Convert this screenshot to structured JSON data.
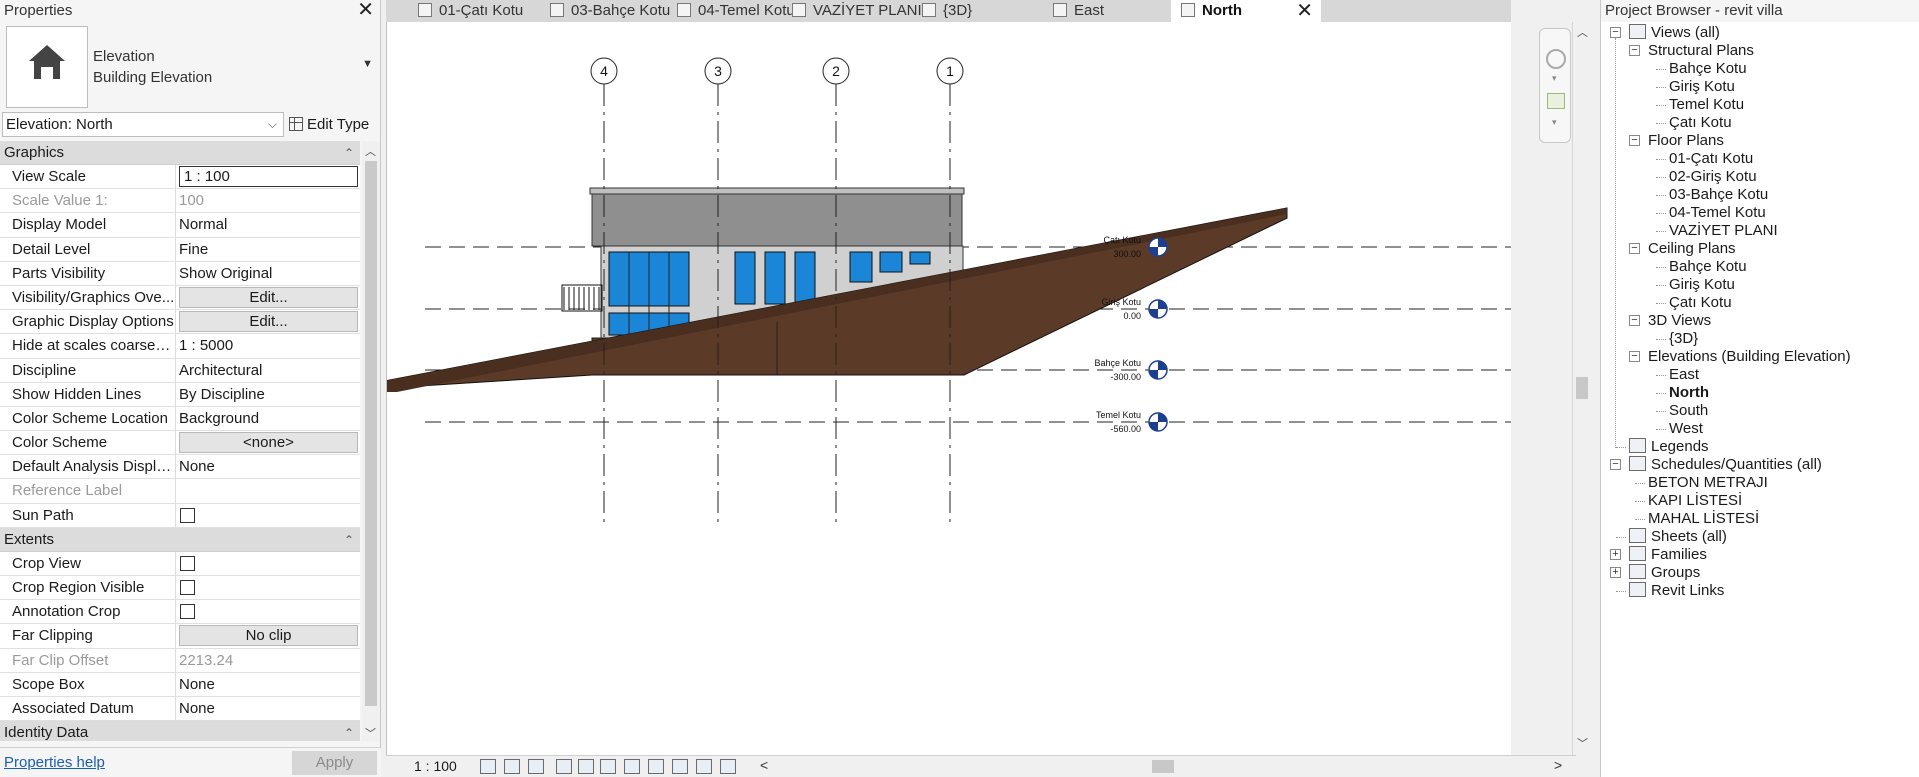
{
  "properties": {
    "title": "Properties",
    "type_category": "Elevation",
    "type_name": "Building Elevation",
    "instance_selector": "Elevation: North",
    "edit_type": "Edit Type",
    "sections": [
      {
        "name": "Graphics",
        "rows": [
          {
            "name": "View Scale",
            "value": "1 : 100",
            "kind": "boxed"
          },
          {
            "name": "Scale Value    1:",
            "value": "100",
            "kind": "grey"
          },
          {
            "name": "Display Model",
            "value": "Normal",
            "kind": "text"
          },
          {
            "name": "Detail Level",
            "value": "Fine",
            "kind": "text"
          },
          {
            "name": "Parts Visibility",
            "value": "Show Original",
            "kind": "text"
          },
          {
            "name": "Visibility/Graphics Ove...",
            "value": "Edit...",
            "kind": "btn"
          },
          {
            "name": "Graphic Display Options",
            "value": "Edit...",
            "kind": "btn"
          },
          {
            "name": "Hide at scales coarser ...",
            "value": "1 : 5000",
            "kind": "text"
          },
          {
            "name": "Discipline",
            "value": "Architectural",
            "kind": "text"
          },
          {
            "name": "Show Hidden Lines",
            "value": "By Discipline",
            "kind": "text"
          },
          {
            "name": "Color Scheme Location",
            "value": "Background",
            "kind": "text"
          },
          {
            "name": "Color Scheme",
            "value": "<none>",
            "kind": "btn"
          },
          {
            "name": "Default Analysis Displa...",
            "value": "None",
            "kind": "text"
          },
          {
            "name": "Reference Label",
            "value": "",
            "kind": "grey"
          },
          {
            "name": "Sun Path",
            "value": "",
            "kind": "check"
          }
        ]
      },
      {
        "name": "Extents",
        "rows": [
          {
            "name": "Crop View",
            "value": "",
            "kind": "check"
          },
          {
            "name": "Crop Region Visible",
            "value": "",
            "kind": "check"
          },
          {
            "name": "Annotation Crop",
            "value": "",
            "kind": "check"
          },
          {
            "name": "Far Clipping",
            "value": "No clip",
            "kind": "btn"
          },
          {
            "name": "Far Clip Offset",
            "value": "2213.24",
            "kind": "grey"
          },
          {
            "name": "Scope Box",
            "value": "None",
            "kind": "text"
          },
          {
            "name": "Associated Datum",
            "value": "None",
            "kind": "text"
          }
        ]
      },
      {
        "name": "Identity Data",
        "rows": []
      }
    ],
    "help_link": "Properties help",
    "apply_button": "Apply"
  },
  "tabs": [
    {
      "label": "01-Çatı Kotu",
      "icon": "floor-plan-icon",
      "active": false
    },
    {
      "label": "03-Bahçe Kotu",
      "icon": "floor-plan-icon",
      "active": false
    },
    {
      "label": "04-Temel Kotu",
      "icon": "floor-plan-icon",
      "active": false
    },
    {
      "label": "VAZİYET PLANI",
      "icon": "floor-plan-icon",
      "active": false
    },
    {
      "label": "{3D}",
      "icon": "cube-3d-icon",
      "active": false
    },
    {
      "label": "East",
      "icon": "elevation-icon",
      "active": false
    },
    {
      "label": "North",
      "icon": "elevation-icon",
      "active": true
    }
  ],
  "canvas": {
    "grids": [
      "4",
      "3",
      "2",
      "1"
    ],
    "levels": [
      {
        "name": "Çatı Kotu",
        "value": "300.00"
      },
      {
        "name": "Giriş Kotu",
        "value": "0.00"
      },
      {
        "name": "Bahçe Kotu",
        "value": "-300.00"
      },
      {
        "name": "Temel Kotu",
        "value": "-560.00"
      }
    ],
    "colors": {
      "terrain": "#5b3b28",
      "roof": "#8f8f8f",
      "glass": "#1b86d8",
      "wall": "#d0d0d0"
    }
  },
  "view_control": {
    "scale": "1 : 100"
  },
  "browser": {
    "title": "Project Browser - revit villa",
    "tree": [
      {
        "label": "Views (all)",
        "level": 0,
        "toggle": "-",
        "icon": "views-icon"
      },
      {
        "label": "Structural Plans",
        "level": 1,
        "toggle": "-"
      },
      {
        "label": "Bahçe Kotu",
        "level": 2
      },
      {
        "label": "Giriş Kotu",
        "level": 2
      },
      {
        "label": "Temel Kotu",
        "level": 2
      },
      {
        "label": "Çatı Kotu",
        "level": 2
      },
      {
        "label": "Floor Plans",
        "level": 1,
        "toggle": "-"
      },
      {
        "label": "01-Çatı Kotu",
        "level": 2
      },
      {
        "label": "02-Giriş Kotu",
        "level": 2
      },
      {
        "label": "03-Bahçe Kotu",
        "level": 2
      },
      {
        "label": "04-Temel Kotu",
        "level": 2
      },
      {
        "label": "VAZİYET PLANI",
        "level": 2
      },
      {
        "label": "Ceiling Plans",
        "level": 1,
        "toggle": "-"
      },
      {
        "label": "Bahçe Kotu",
        "level": 2
      },
      {
        "label": "Giriş Kotu",
        "level": 2
      },
      {
        "label": "Çatı Kotu",
        "level": 2
      },
      {
        "label": "3D Views",
        "level": 1,
        "toggle": "-"
      },
      {
        "label": "{3D}",
        "level": 2
      },
      {
        "label": "Elevations (Building Elevation)",
        "level": 1,
        "toggle": "-"
      },
      {
        "label": "East",
        "level": 2
      },
      {
        "label": "North",
        "level": 2,
        "bold": true
      },
      {
        "label": "South",
        "level": 2
      },
      {
        "label": "West",
        "level": 2
      },
      {
        "label": "Legends",
        "level": 0,
        "icon": "legends-icon"
      },
      {
        "label": "Schedules/Quantities (all)",
        "level": 0,
        "toggle": "-",
        "icon": "schedule-icon"
      },
      {
        "label": "BETON METRAJI",
        "level": 1
      },
      {
        "label": "KAPI LİSTESİ",
        "level": 1
      },
      {
        "label": "MAHAL LİSTESİ",
        "level": 1
      },
      {
        "label": "Sheets (all)",
        "level": 0,
        "icon": "sheets-icon"
      },
      {
        "label": "Families",
        "level": 0,
        "toggle": "+",
        "icon": "families-icon"
      },
      {
        "label": "Groups",
        "level": 0,
        "toggle": "+",
        "icon": "groups-icon"
      },
      {
        "label": "Revit Links",
        "level": 0,
        "icon": "revit-links-icon"
      }
    ]
  }
}
